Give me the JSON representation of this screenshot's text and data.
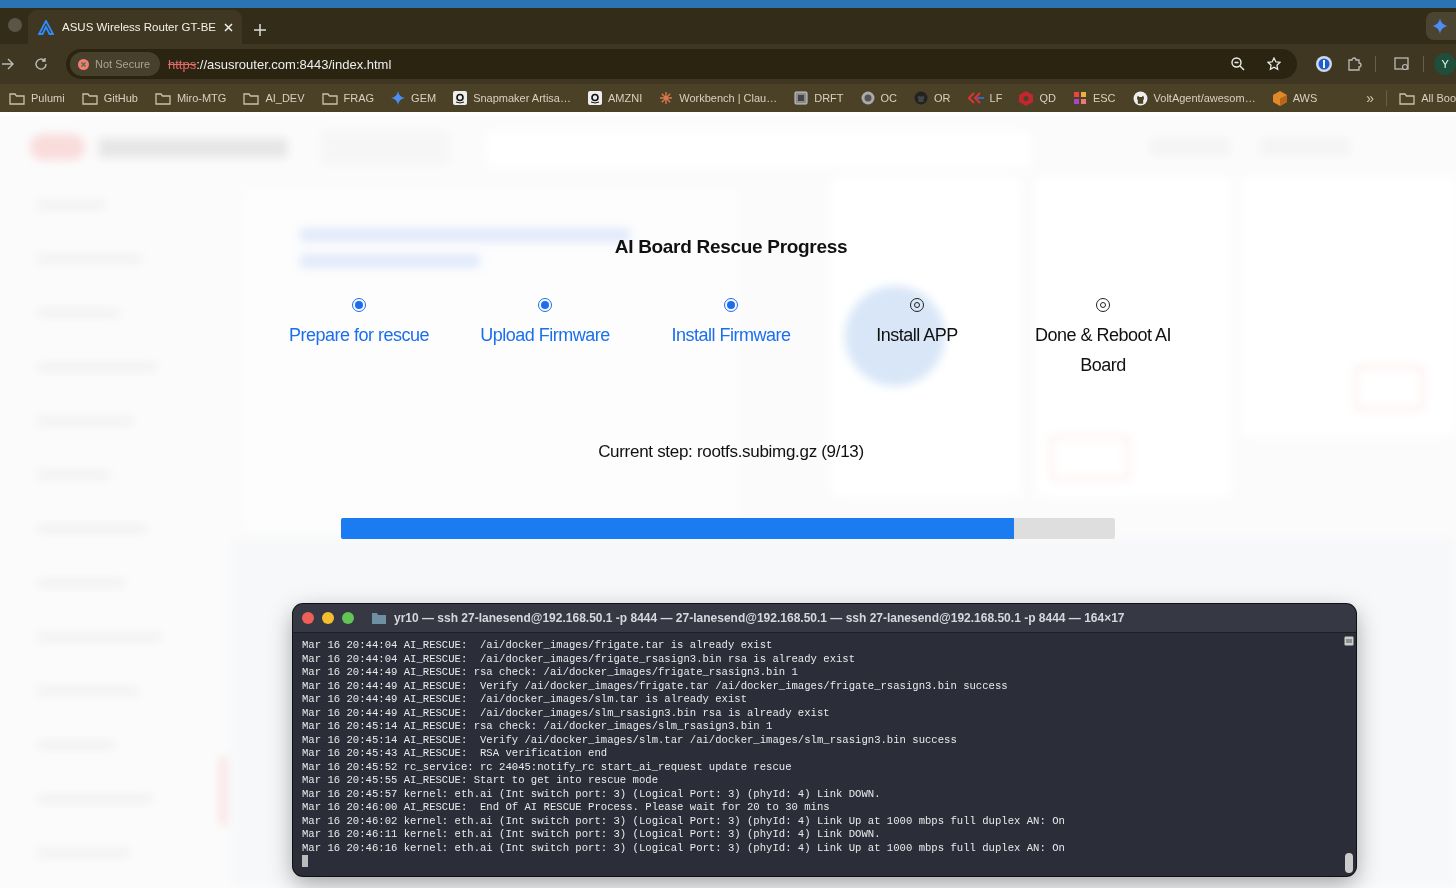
{
  "browser": {
    "tab": {
      "title": "ASUS Wireless Router GT-BE",
      "selected": true
    },
    "address": {
      "security": "Not Secure",
      "scheme": "https",
      "rest": "://asusrouter.com:8443/index.html"
    },
    "avatar": "Y",
    "bookmarks": [
      {
        "label": "Pulumi",
        "kind": "folder"
      },
      {
        "label": "GitHub",
        "kind": "folder"
      },
      {
        "label": "Miro-MTG",
        "kind": "folder"
      },
      {
        "label": "AI_DEV",
        "kind": "folder"
      },
      {
        "label": "FRAG",
        "kind": "folder"
      },
      {
        "label": "GEM",
        "kind": "sparkle"
      },
      {
        "label": "Snapmaker Artisa…",
        "kind": "letter-a"
      },
      {
        "label": "AMZNI",
        "kind": "letter-a"
      },
      {
        "label": "Workbench | Clau…",
        "kind": "burst"
      },
      {
        "label": "DRFT",
        "kind": "square"
      },
      {
        "label": "OC",
        "kind": "disc"
      },
      {
        "label": "OR",
        "kind": "github-dark"
      },
      {
        "label": "LF",
        "kind": "chevrons"
      },
      {
        "label": "QD",
        "kind": "hexagon"
      },
      {
        "label": "ESC",
        "kind": "cubes"
      },
      {
        "label": "VoltAgent/awesom…",
        "kind": "github"
      },
      {
        "label": "AWS",
        "kind": "cube"
      }
    ],
    "more": "»",
    "all_bookmarks": "All Boo"
  },
  "rescue": {
    "title": "AI Board Rescue Progress",
    "steps": [
      {
        "label": "Prepare for rescue",
        "done": true
      },
      {
        "label": "Upload Firmware",
        "done": true
      },
      {
        "label": "Install Firmware",
        "done": true
      },
      {
        "label": "Install APP",
        "done": false
      },
      {
        "label": "Done & Reboot AI Board",
        "done": false
      }
    ],
    "current_step": "Current step: rootfs.subimg.gz (9/13)",
    "progress": {
      "level": 0.87
    }
  },
  "terminal": {
    "title": "yr10 — ssh 27-lanesend@192.168.50.1 -p 8444 — 27-lanesend@192.168.50.1 — ssh 27-lanesend@192.168.50.1 -p 8444 — 164×17",
    "lines": [
      "Mar 16 20:44:04 AI_RESCUE:  /ai/docker_images/frigate.tar is already exist",
      "Mar 16 20:44:04 AI_RESCUE:  /ai/docker_images/frigate_rsasign3.bin rsa is already exist",
      "Mar 16 20:44:49 AI_RESCUE: rsa check: /ai/docker_images/frigate_rsasign3.bin 1",
      "Mar 16 20:44:49 AI_RESCUE:  Verify /ai/docker_images/frigate.tar /ai/docker_images/frigate_rsasign3.bin success",
      "Mar 16 20:44:49 AI_RESCUE:  /ai/docker_images/slm.tar is already exist",
      "Mar 16 20:44:49 AI_RESCUE:  /ai/docker_images/slm_rsasign3.bin rsa is already exist",
      "Mar 16 20:45:14 AI_RESCUE: rsa check: /ai/docker_images/slm_rsasign3.bin 1",
      "Mar 16 20:45:14 AI_RESCUE:  Verify /ai/docker_images/slm.tar /ai/docker_images/slm_rsasign3.bin success",
      "Mar 16 20:45:43 AI_RESCUE:  RSA verification end",
      "Mar 16 20:45:52 rc_service: rc 24045:notify_rc start_ai_request update rescue",
      "Mar 16 20:45:55 AI_RESCUE: Start to get into rescue mode",
      "Mar 16 20:45:57 kernel: eth.ai (Int switch port: 3) (Logical Port: 3) (phyId: 4) Link DOWN.",
      "Mar 16 20:46:00 AI_RESCUE:  End Of AI RESCUE Process. Please wait for 20 to 30 mins",
      "Mar 16 20:46:02 kernel: eth.ai (Int switch port: 3) (Logical Port: 3) (phyId: 4) Link Up at 1000 mbps full duplex AN: On",
      "Mar 16 20:46:11 kernel: eth.ai (Int switch port: 3) (Logical Port: 3) (phyId: 4) Link DOWN.",
      "Mar 16 20:46:16 kernel: eth.ai (Int switch port: 3) (Logical Port: 3) (phyId: 4) Link Up at 1000 mbps full duplex AN: On"
    ]
  }
}
